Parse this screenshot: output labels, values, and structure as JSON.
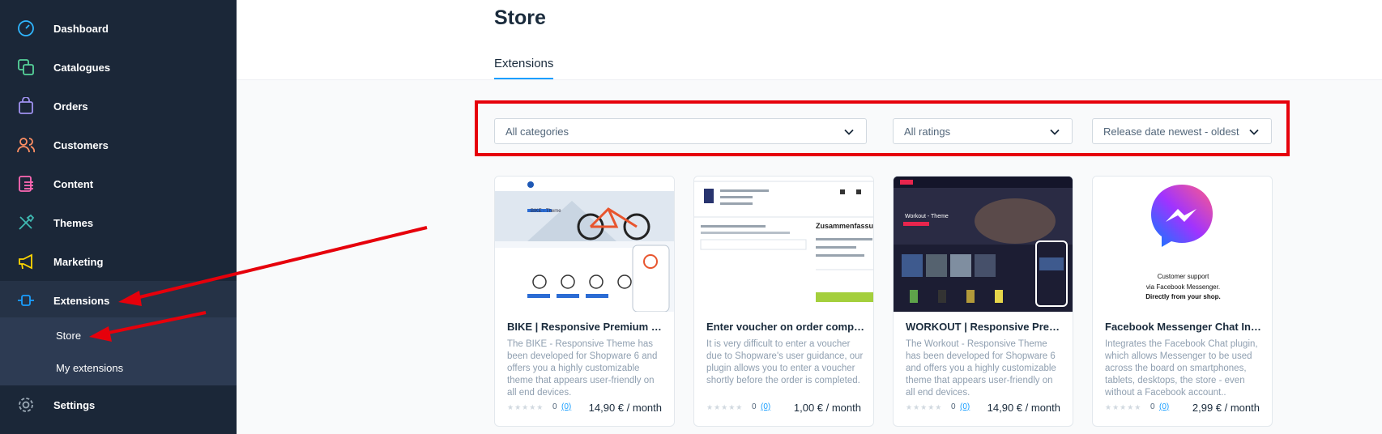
{
  "sidebar": {
    "items": [
      {
        "label": "Dashboard",
        "icon": "gauge-icon",
        "color": "#2fb6ff"
      },
      {
        "label": "Catalogues",
        "icon": "catalogue-icon",
        "color": "#56d39a"
      },
      {
        "label": "Orders",
        "icon": "shopping-bag-icon",
        "color": "#a092f0"
      },
      {
        "label": "Customers",
        "icon": "users-icon",
        "color": "#ff8f63"
      },
      {
        "label": "Content",
        "icon": "content-list-icon",
        "color": "#ff68b4"
      },
      {
        "label": "Themes",
        "icon": "paint-brush-icon",
        "color": "#3fb9b2"
      },
      {
        "label": "Marketing",
        "icon": "megaphone-icon",
        "color": "#ffd700"
      },
      {
        "label": "Extensions",
        "icon": "plug-icon",
        "color": "#189eff"
      },
      {
        "label": "Settings",
        "icon": "gear-icon",
        "color": "#9aa8b5"
      }
    ],
    "sub_items": [
      {
        "label": "Store"
      },
      {
        "label": "My extensions"
      }
    ]
  },
  "header": {
    "title": "Store",
    "tab": "Extensions"
  },
  "filters": {
    "category": "All categories",
    "rating": "All ratings",
    "sort": "Release date newest - oldest"
  },
  "cards": [
    {
      "title": "BIKE | Responsive Premium Theme",
      "description": "The BIKE - Responsive Theme has been developed for Shopware 6 and offers you a highly customizable theme that appears user-friendly on all end devices.",
      "rating_count": "0",
      "rating_link": "(0)",
      "price": "14,90 € / month",
      "thumb_text": "BIKE - Theme"
    },
    {
      "title": "Enter voucher on order completion",
      "description": "It is very difficult to enter a voucher due to Shopware's user guidance, our plugin allows you to enter a voucher shortly before the order is completed.",
      "rating_count": "0",
      "rating_link": "(0)",
      "price": "1,00 € / month",
      "thumb_text": "Zusammenfassung"
    },
    {
      "title": "WORKOUT | Responsive Premium Theme",
      "description": "The Workout - Responsive Theme has been developed for Shopware 6 and offers you a highly customizable theme that appears user-friendly on all end devices.",
      "rating_count": "0",
      "rating_link": "(0)",
      "price": "14,90 € / month",
      "thumb_text": "Workout - Theme"
    },
    {
      "title": "Facebook Messenger Chat Integration",
      "description": "Integrates the Facebook Chat plugin, which allows Messenger to be used across the board on smartphones, tablets, desktops, the store - even without a Facebook account..",
      "rating_count": "0",
      "rating_link": "(0)",
      "price": "2,99 € / month",
      "thumb_line1": "Customer support",
      "thumb_line2": "via Facebook Messenger.",
      "thumb_line3": "Directly from your shop."
    }
  ]
}
